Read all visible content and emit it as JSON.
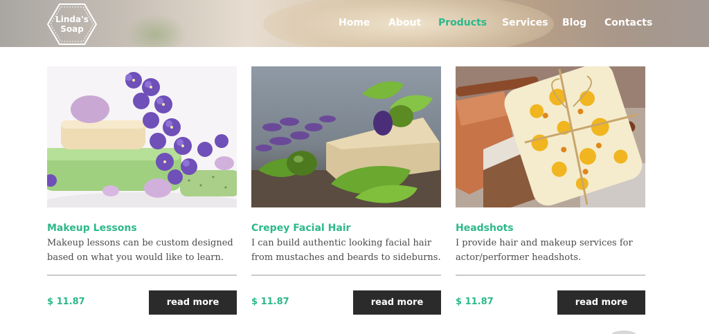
{
  "header": {
    "logo_text": "Linda's Soap",
    "nav": [
      {
        "label": "Home",
        "active": false
      },
      {
        "label": "About",
        "active": false
      },
      {
        "label": "Products",
        "active": true
      },
      {
        "label": "Services",
        "active": false
      },
      {
        "label": "Blog",
        "active": false
      },
      {
        "label": "Contacts",
        "active": false
      }
    ]
  },
  "cards": [
    {
      "image": "lavender-soap-photo",
      "title": "Makeup Lessons",
      "description": "Makeup lessons can be custom designed based on what you would like to learn.",
      "price": "$ 11.87",
      "button": "read more"
    },
    {
      "image": "olive-leaf-soap-photo",
      "title": "Crepey Facial Hair",
      "description": "I can build authentic looking facial hair from mustaches and beards to sideburns.",
      "price": "$ 11.87",
      "button": "read more"
    },
    {
      "image": "saffron-cinnamon-soap-photo",
      "title": "Headshots",
      "description": "I provide hair and makeup services for actor/performer headshots.",
      "price": "$ 11.87",
      "button": "read more"
    }
  ],
  "colors": {
    "accent": "#2cb88a",
    "button_bg": "#2b2b2b",
    "text": "#4a4a4a"
  }
}
